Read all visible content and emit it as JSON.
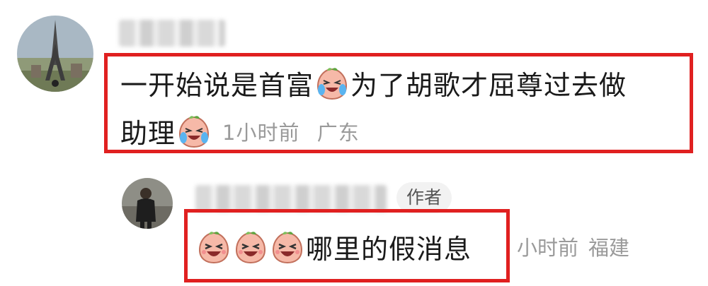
{
  "comment": {
    "text_part1": "一开始说是首富",
    "text_part2": "为了胡歌才屈尊过去做",
    "text_part3": "助理",
    "time": "1小时前",
    "location": "广东",
    "emoji_name": "crying-laughing-peach-emoji"
  },
  "reply": {
    "author_badge": "作者",
    "text": "哪里的假消息",
    "time": "小时前",
    "location": "福建",
    "emoji_name": "laughing-peach-emoji"
  },
  "colors": {
    "highlight": "#e02020",
    "meta": "#9a9a9a"
  }
}
